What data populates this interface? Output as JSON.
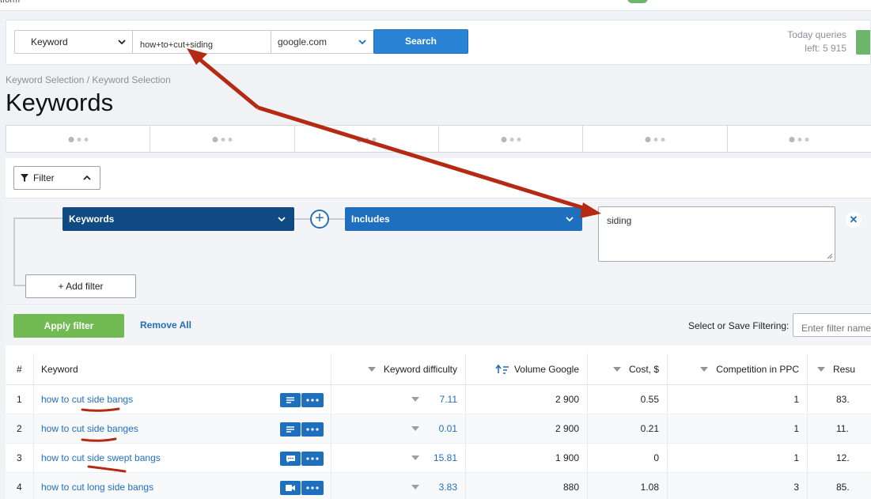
{
  "top": {
    "fragment": "tform"
  },
  "search": {
    "type_label": "Keyword",
    "query": "how+to+cut+siding",
    "database": "google.com",
    "button": "Search",
    "queries_line1": "Today queries",
    "queries_line2": "left: 5 915"
  },
  "breadcrumb": "Keyword Selection / Keyword Selection",
  "title": "Keywords",
  "filter": {
    "toggle_label": "Filter",
    "field": "Keywords",
    "operator": "Includes",
    "value": "siding",
    "add_filter": "+ Add filter",
    "apply": "Apply filter",
    "remove_all": "Remove All",
    "save_label": "Select or Save Filtering:",
    "save_placeholder": "Enter filter name"
  },
  "table": {
    "headers": {
      "num": "#",
      "keyword": "Keyword",
      "difficulty": "Keyword difficulty",
      "volume": "Volume Google",
      "cost": "Cost, $",
      "competition": "Competition in PPC",
      "results": "Resu"
    },
    "rows": [
      {
        "num": "1",
        "keyword": "how to cut side bangs",
        "difficulty": "7.11",
        "volume": "2 900",
        "cost": "0.55",
        "competition": "1",
        "results": "83.",
        "icon": "list-icon"
      },
      {
        "num": "2",
        "keyword": "how to cut side banges",
        "difficulty": "0.01",
        "volume": "2 900",
        "cost": "0.21",
        "competition": "1",
        "results": "11.",
        "icon": "list-icon"
      },
      {
        "num": "3",
        "keyword": "how to cut side swept bangs",
        "difficulty": "15.81",
        "volume": "1 900",
        "cost": "0",
        "competition": "1",
        "results": "12.",
        "icon": "comment-icon"
      },
      {
        "num": "4",
        "keyword": "how to cut long side bangs",
        "difficulty": "3.83",
        "volume": "880",
        "cost": "1.08",
        "competition": "3",
        "results": "85.",
        "icon": "video-icon"
      }
    ]
  },
  "colors": {
    "primary_blue": "#2b83d6",
    "dark_blue": "#0f4a82",
    "green": "#72bb53",
    "annotation_red": "#b52a12"
  }
}
